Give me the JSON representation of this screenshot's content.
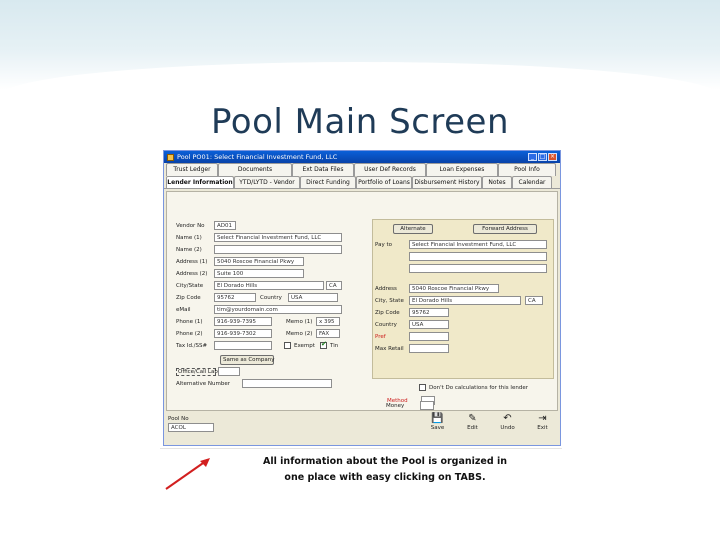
{
  "slide": {
    "title": "Pool Main Screen"
  },
  "window": {
    "title": "Pool PO01: Select Financial Investment Fund, LLC",
    "controls": [
      "_",
      "□",
      "×"
    ]
  },
  "tabs_row1": [
    "Trust Ledger",
    "Documents",
    "Ext Data Files",
    "User Def Records",
    "Loan Expenses",
    "Pool Info"
  ],
  "tabs_row2": [
    "Lender Information",
    "YTD/LYTD - Vendor",
    "Direct Funding",
    "Portfolio of Loans",
    "Disbursement History",
    "Notes",
    "Calendar"
  ],
  "lender": {
    "rows": [
      {
        "label": "Vendor No",
        "value": "AD01"
      },
      {
        "label": "Name (1)",
        "value": "Select Financial Investment Fund, LLC"
      },
      {
        "label": "Name (2)",
        "value": ""
      },
      {
        "label": "Address (1)",
        "value": "5040 Roscoe Financial Pkwy"
      },
      {
        "label": "Address (2)",
        "value": "Suite 100"
      },
      {
        "label": "City/State",
        "value": "El Dorado Hills",
        "state": "CA"
      },
      {
        "label": "Zip Code",
        "value": "95762",
        "country_label": "Country",
        "country": "USA"
      },
      {
        "label": "eMail",
        "value": "tim@yourdomain.com"
      },
      {
        "label": "Phone (1)",
        "value": "916-939-7395",
        "memo_label": "Memo (1)",
        "memo": "x 395"
      },
      {
        "label": "Phone (2)",
        "value": "916-939-7302",
        "memo_label": "Memo (2)",
        "memo": "FAX"
      },
      {
        "label": "Tax Id./SS#",
        "value": "",
        "exempt_label": "Exempt",
        "tin_label": "Tin"
      }
    ],
    "same_as_button": "Same as Company",
    "office_label": "Office/Call Label",
    "alt_label": "Alternative Number"
  },
  "payee": {
    "buttons": [
      "Alternate",
      "Forward Address"
    ],
    "rows": [
      {
        "label": "Pay to",
        "value": "Select Financial Investment Fund, LLC"
      },
      {
        "label": "Address",
        "value": "5040 Roscoe Financial Pkwy"
      },
      {
        "label": "City, State",
        "value": "El Dorado Hills",
        "state": "CA"
      },
      {
        "label": "Zip Code",
        "value": "95762"
      },
      {
        "label": "Country",
        "value": "USA"
      },
      {
        "label": "Pref",
        "value": ""
      },
      {
        "label": "Max Retail",
        "value": ""
      }
    ],
    "dont_calc_label": "Don't Do calculations for this lender",
    "method_label": "Method",
    "money_label": "Money"
  },
  "pool": {
    "label": "Pool No",
    "value": "ACOL"
  },
  "toolbar": [
    {
      "icon": "save",
      "label": "Save"
    },
    {
      "icon": "edit",
      "label": "Edit"
    },
    {
      "icon": "undo",
      "label": "Undo"
    },
    {
      "icon": "exit",
      "label": "Exit"
    }
  ],
  "callout": {
    "line1": "All information about the Pool is organized in",
    "line2": "one place with easy clicking on TABS."
  }
}
